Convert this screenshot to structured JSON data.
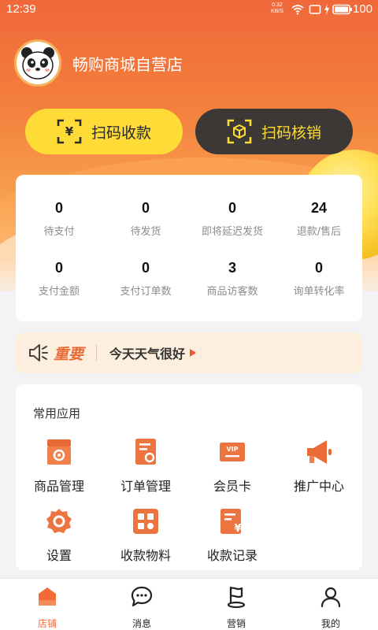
{
  "status_bar": {
    "time": "12:39",
    "net_speed": "0.32",
    "net_unit": "KB/S",
    "battery": "100"
  },
  "store": {
    "name": "畅购商城自营店"
  },
  "actions": {
    "receive_label": "扫码收款",
    "verify_label": "扫码核销"
  },
  "stats": [
    {
      "value": "0",
      "label": "待支付"
    },
    {
      "value": "0",
      "label": "待发货"
    },
    {
      "value": "0",
      "label": "即将延迟发货"
    },
    {
      "value": "24",
      "label": "退款/售后"
    },
    {
      "value": "0",
      "label": "支付金额"
    },
    {
      "value": "0",
      "label": "支付订单数"
    },
    {
      "value": "3",
      "label": "商品访客数"
    },
    {
      "value": "0",
      "label": "询单转化率"
    }
  ],
  "notice": {
    "tag": "重要",
    "message": "今天天气很好"
  },
  "apps": {
    "title": "常用应用",
    "items": [
      {
        "label": "商品管理",
        "icon": "product-management-icon"
      },
      {
        "label": "订单管理",
        "icon": "order-management-icon"
      },
      {
        "label": "会员卡",
        "icon": "vip-card-icon"
      },
      {
        "label": "推广中心",
        "icon": "megaphone-icon"
      },
      {
        "label": "设置",
        "icon": "settings-gear-icon"
      },
      {
        "label": "收款物料",
        "icon": "qr-material-icon"
      },
      {
        "label": "收款记录",
        "icon": "payment-record-icon"
      }
    ]
  },
  "tabs": [
    {
      "label": "店铺",
      "icon": "store-icon",
      "active": true
    },
    {
      "label": "消息",
      "icon": "chat-icon",
      "active": false
    },
    {
      "label": "营销",
      "icon": "flag-icon",
      "active": false
    },
    {
      "label": "我的",
      "icon": "user-icon",
      "active": false
    }
  ],
  "colors": {
    "accent": "#f26a38",
    "yellow": "#fedb37",
    "dark": "#3b3836",
    "notice_bg": "#fdeedd"
  }
}
